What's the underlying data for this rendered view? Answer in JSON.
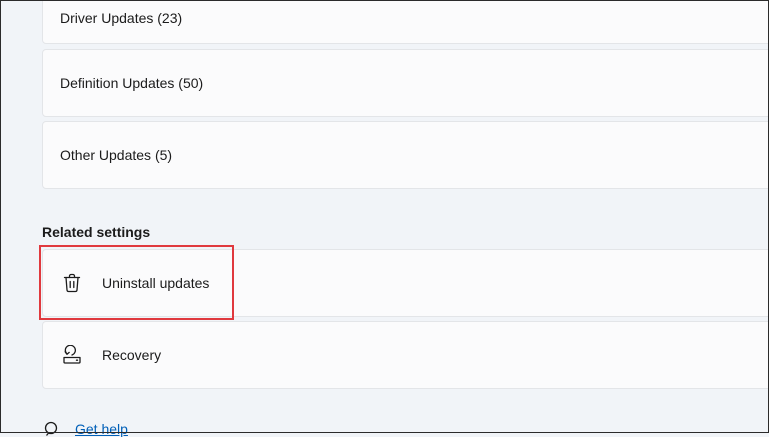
{
  "updates": {
    "driver": "Driver Updates (23)",
    "definition": "Definition Updates (50)",
    "other": "Other Updates (5)"
  },
  "related_settings": {
    "heading": "Related settings",
    "items": [
      {
        "label": "Uninstall updates",
        "icon": "trash-icon"
      },
      {
        "label": "Recovery",
        "icon": "recovery-icon"
      }
    ]
  },
  "help": {
    "label": "Get help",
    "icon": "help-icon"
  },
  "colors": {
    "highlight": "#e0393e",
    "link": "#005fb8",
    "card_bg": "#fbfbfc",
    "page_bg": "#f1f4f8"
  }
}
